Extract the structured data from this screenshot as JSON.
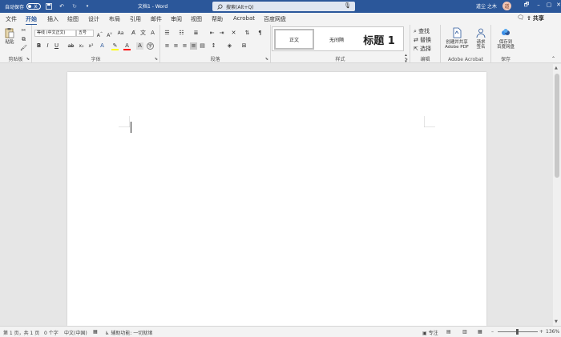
{
  "titlebar": {
    "autosave_label": "自动保存",
    "autosave_state": "关",
    "doc_title": "文档1 - Word",
    "search_placeholder": "搜索(Alt+Q)",
    "user_name": "道尘 之木",
    "avatar_initial": "道"
  },
  "tabs": [
    "文件",
    "开始",
    "插入",
    "绘图",
    "设计",
    "布局",
    "引用",
    "邮件",
    "审阅",
    "视图",
    "帮助",
    "Acrobat",
    "百度网盘"
  ],
  "active_tab": "开始",
  "share_label": "共享",
  "ribbon": {
    "clipboard": {
      "paste": "粘贴",
      "label": "剪贴板"
    },
    "font": {
      "font_name": "等线 (中文正文)",
      "font_size": "五号",
      "label": "字体"
    },
    "paragraph": {
      "label": "段落"
    },
    "styles": {
      "normal": "正文",
      "no_spacing": "无间隔",
      "heading1": "标题 1",
      "label": "样式"
    },
    "editing": {
      "find": "查找",
      "replace": "替换",
      "select": "选择",
      "label": "编辑"
    },
    "acrobat": {
      "create_share": "创建并共享",
      "create_share2": "Adobe PDF",
      "request": "请求",
      "request2": "签名",
      "label": "Adobe Acrobat"
    },
    "save": {
      "save_to": "保存到",
      "save_to2": "百度网盘",
      "label": "保存"
    }
  },
  "statusbar": {
    "page": "第 1 页，共 1 页",
    "words": "0 个字",
    "language": "中文(中国)",
    "accessibility": "辅助功能: 一切就绪",
    "focus": "专注",
    "zoom": "136%"
  },
  "colors": {
    "brand": "#2b579a",
    "highlight": "#ffff00",
    "font_color": "#ff0000"
  }
}
